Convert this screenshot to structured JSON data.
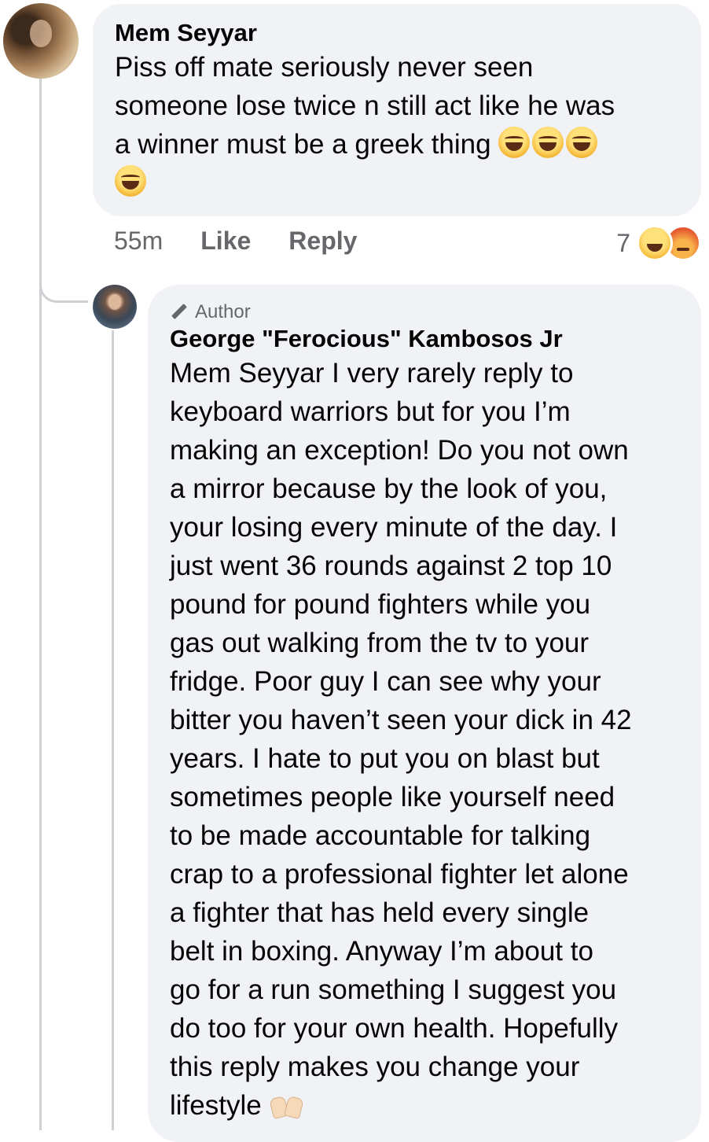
{
  "comment": {
    "author": "Mem Seyyar",
    "text": "Piss off mate seriously never seen\nsomeone lose twice n still act like he was\na winner must be a greek thing",
    "trailing_emojis": [
      "face-with-tears-of-joy",
      "face-with-tears-of-joy",
      "face-with-tears-of-joy",
      "face-with-tears-of-joy"
    ],
    "time": "55m",
    "like_label": "Like",
    "reply_label": "Reply",
    "reaction_count": "7",
    "reactions": [
      "haha",
      "angry"
    ]
  },
  "reply": {
    "badge": "Author",
    "author": "George \"Ferocious\" Kambosos Jr",
    "text": "Mem Seyyar I very rarely reply to\nkeyboard warriors but for you I’m\nmaking an exception! Do you not own\na mirror because by the look of you,\nyour losing every minute of the day. I\njust went 36 rounds against 2 top 10\npound for pound fighters while you\ngas out walking from the tv to your\nfridge. Poor guy I can see why your\nbitter you haven’t seen your dick in 42\nyears. I hate to put you on blast but\nsometimes people like yourself need\nto be made accountable for talking\ncrap to a professional fighter let alone\na fighter that has held every single\nbelt in boxing. Anyway I’m about to\ngo for a run something I suggest you\ndo too for your own health. Hopefully\nthis reply makes you change your\nlifestyle",
    "trailing_emoji": "raising-hands"
  }
}
